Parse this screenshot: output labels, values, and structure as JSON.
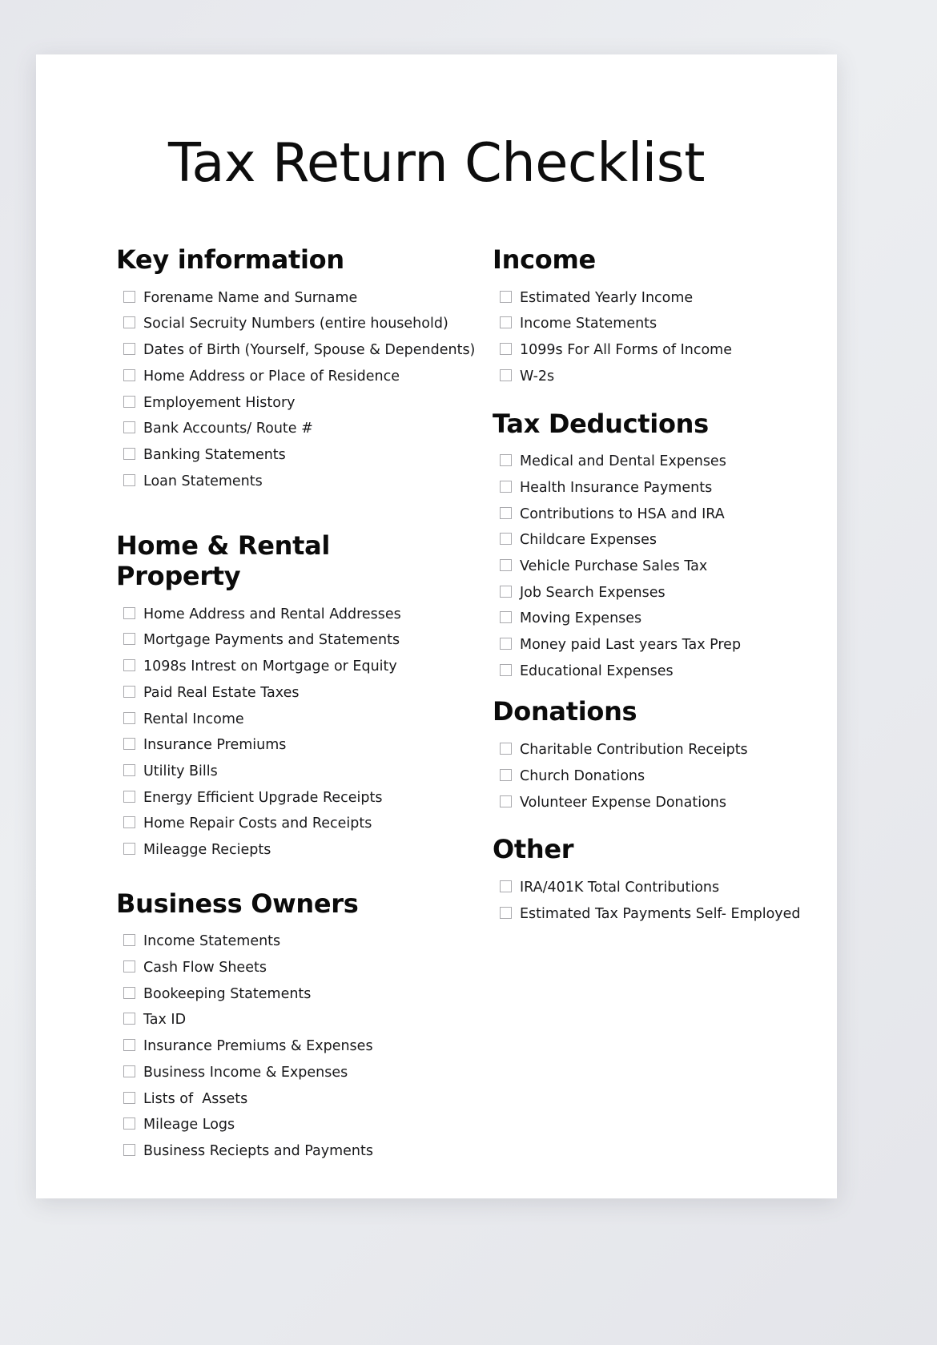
{
  "document": {
    "title": "Tax Return Checklist"
  },
  "left_column": [
    {
      "heading": "Key information",
      "items": [
        "Forename Name and Surname",
        "Social Secruity Numbers (entire household)",
        "Dates of Birth (Yourself, Spouse & Dependents)",
        "Home Address or Place of Residence",
        "Employement History",
        "Bank Accounts/ Route #",
        "Banking Statements",
        "Loan Statements"
      ]
    },
    {
      "heading": "Home & Rental Property",
      "items": [
        "Home Address and Rental Addresses",
        "Mortgage Payments and Statements",
        "1098s Intrest on Mortgage or Equity",
        "Paid Real Estate Taxes",
        "Rental Income",
        "Insurance Premiums",
        "Utility Bills",
        "Energy Efficient Upgrade Receipts",
        "Home Repair Costs and Receipts",
        "Mileagge Reciepts"
      ]
    },
    {
      "heading": "Business Owners",
      "items": [
        "Income Statements",
        "Cash Flow Sheets",
        "Bookeeping Statements",
        "Tax ID",
        "Insurance Premiums & Expenses",
        "Business Income & Expenses",
        "Lists of  Assets",
        "Mileage Logs",
        "Business Reciepts and Payments"
      ]
    }
  ],
  "right_column": [
    {
      "heading": "Income",
      "items": [
        "Estimated Yearly Income",
        "Income Statements",
        "1099s For All Forms of Income",
        "W-2s"
      ]
    },
    {
      "heading": "Tax Deductions",
      "items": [
        "Medical and Dental Expenses",
        "Health Insurance Payments",
        "Contributions to HSA and IRA",
        "Childcare Expenses",
        "Vehicle Purchase Sales Tax",
        "Job Search Expenses",
        "Moving Expenses",
        "Money paid Last years Tax Prep",
        "Educational Expenses"
      ]
    },
    {
      "heading": "Donations",
      "items": [
        "Charitable Contribution Receipts",
        "Church Donations",
        "Volunteer Expense Donations"
      ]
    },
    {
      "heading": "Other",
      "items": [
        "IRA/401K Total Contributions",
        "Estimated Tax Payments Self- Employed"
      ]
    }
  ],
  "style": {
    "page_background": "#ffffff",
    "backdrop": "#e9eaee",
    "text_color": "#18181a",
    "checkbox_border": "#a9a9ad"
  }
}
